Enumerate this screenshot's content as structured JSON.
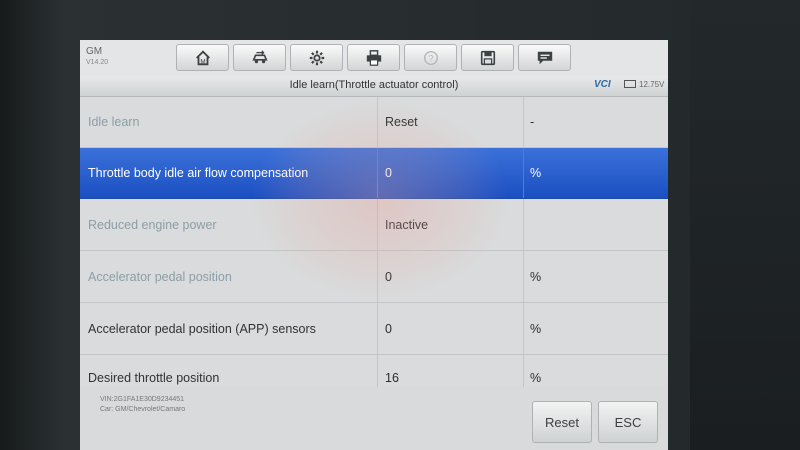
{
  "brand": {
    "make": "GM",
    "version": "V14.20"
  },
  "toolbar": {
    "buttons": [
      {
        "icon": "home-icon",
        "enabled": true
      },
      {
        "icon": "vehicle-swap-icon",
        "enabled": true
      },
      {
        "icon": "gear-icon",
        "enabled": true
      },
      {
        "icon": "printer-icon",
        "enabled": true
      },
      {
        "icon": "help-icon",
        "enabled": false
      },
      {
        "icon": "save-icon",
        "enabled": true
      },
      {
        "icon": "feedback-icon",
        "enabled": true
      }
    ]
  },
  "titlebar": {
    "title": "Idle learn(Throttle actuator control)",
    "vci": "VCI",
    "voltage": "12.75V"
  },
  "table": {
    "rows": [
      {
        "name": "Idle learn",
        "value": "Reset",
        "unit": "-"
      },
      {
        "name": "Throttle body idle air flow compensation",
        "value": "0",
        "unit": "%"
      },
      {
        "name": "Reduced engine power",
        "value": "Inactive",
        "unit": ""
      },
      {
        "name": "Accelerator pedal position",
        "value": "0",
        "unit": "%"
      },
      {
        "name": "Accelerator pedal position (APP) sensors",
        "value": "0",
        "unit": "%"
      },
      {
        "name": "Desired throttle position",
        "value": "16",
        "unit": "%"
      }
    ]
  },
  "footer": {
    "vin": "VIN:2G1FA1E30D9234451",
    "car": "Car: GM/Chevrolet/Camaro",
    "reset_label": "Reset",
    "esc_label": "ESC"
  }
}
